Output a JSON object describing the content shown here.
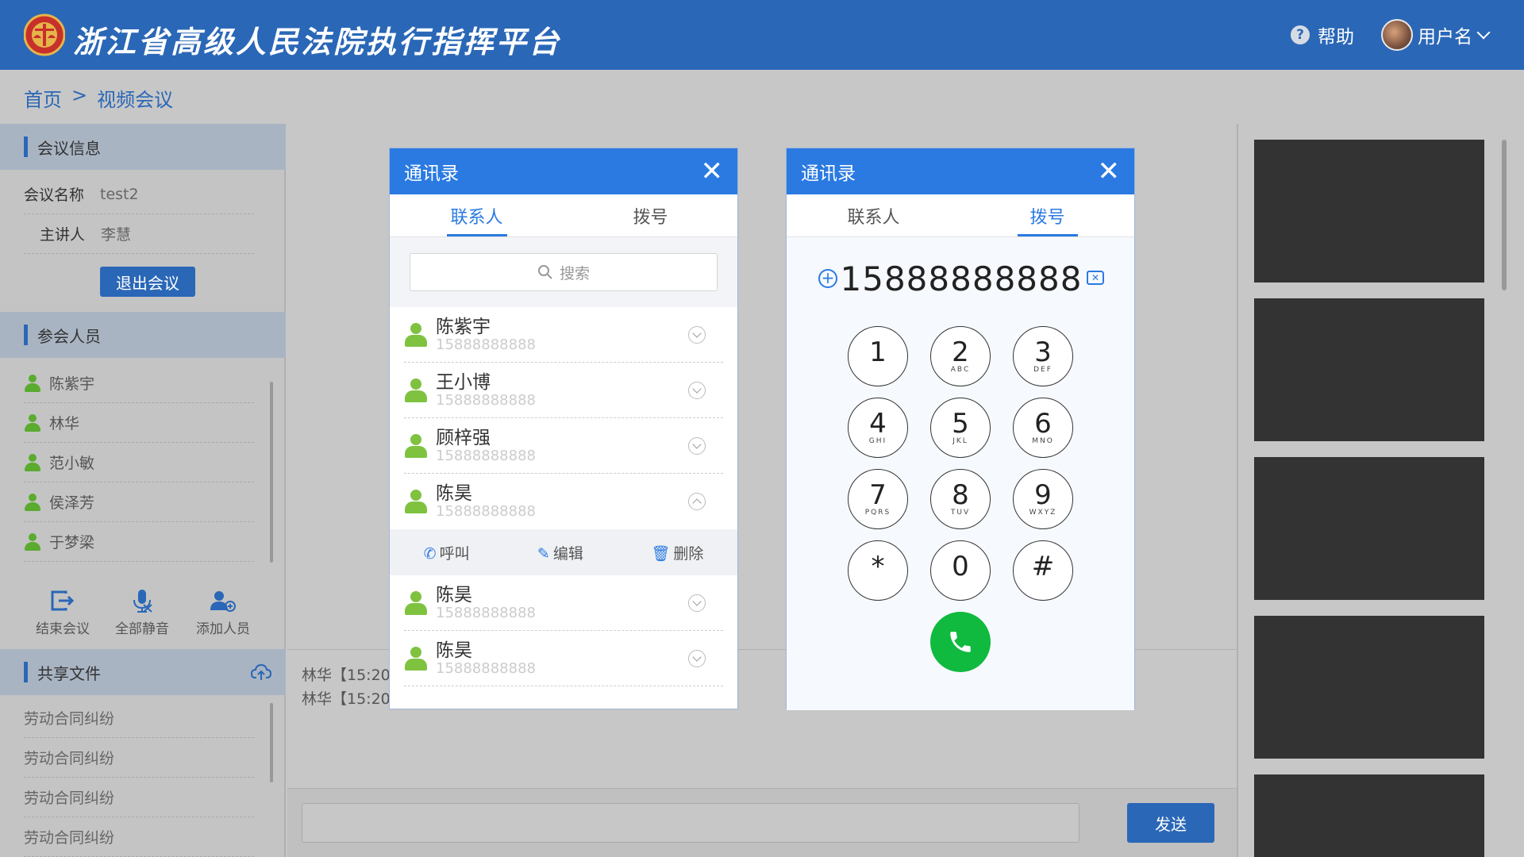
{
  "header": {
    "app_title": "浙江省高级人民法院执行指挥平台",
    "help_label": "帮助",
    "username": "用户名"
  },
  "breadcrumb": {
    "home": "首页",
    "sep": ">",
    "current": "视频会议"
  },
  "sidebar": {
    "meeting_info_title": "会议信息",
    "meeting_name_key": "会议名称",
    "meeting_name_value": "test2",
    "host_key": "主讲人",
    "host_value": "李慧",
    "exit_label": "退出会议",
    "participants_title": "参会人员",
    "participants": [
      "陈紫宇",
      "林华",
      "范小敏",
      "侯泽芳",
      "于梦梁"
    ],
    "actions": [
      "结束会议",
      "全部静音",
      "添加人员"
    ],
    "shared_files_title": "共享文件",
    "files": [
      "劳动合同纠纷",
      "劳动合同纠纷",
      "劳动合同纠纷",
      "劳动合同纠纷"
    ]
  },
  "chat": {
    "lines": [
      "林华【15:20",
      "林华【15:20"
    ],
    "send_label": "发送"
  },
  "contacts_modal": {
    "title": "通讯录",
    "tabs": [
      "联系人",
      "拨号"
    ],
    "search_placeholder": "搜索",
    "contacts": [
      {
        "name": "陈紫宇",
        "phone": "15888888888"
      },
      {
        "name": "王小博",
        "phone": "15888888888"
      },
      {
        "name": "顾梓强",
        "phone": "15888888888"
      },
      {
        "name": "陈昊",
        "phone": "15888888888"
      },
      {
        "name": "陈昊",
        "phone": "15888888888"
      },
      {
        "name": "陈昊",
        "phone": "15888888888"
      }
    ],
    "row_actions": [
      "呼叫",
      "编辑",
      "删除"
    ]
  },
  "dialer_modal": {
    "title": "通讯录",
    "tabs": [
      "联系人",
      "拨号"
    ],
    "number": "15888888888",
    "keys": [
      {
        "d": "1",
        "l": ""
      },
      {
        "d": "2",
        "l": "ABC"
      },
      {
        "d": "3",
        "l": "DEF"
      },
      {
        "d": "4",
        "l": "GHI"
      },
      {
        "d": "5",
        "l": "JKL"
      },
      {
        "d": "6",
        "l": "MNO"
      },
      {
        "d": "7",
        "l": "PQRS"
      },
      {
        "d": "8",
        "l": "TUV"
      },
      {
        "d": "9",
        "l": "WXYZ"
      },
      {
        "d": "*",
        "l": ""
      },
      {
        "d": "0",
        "l": ""
      },
      {
        "d": "#",
        "l": ""
      }
    ]
  },
  "colors": {
    "primary": "#2a67b7",
    "modal_header": "#2a7ae2",
    "call_green": "#0fba3f",
    "person_green": "#5aab2e"
  }
}
